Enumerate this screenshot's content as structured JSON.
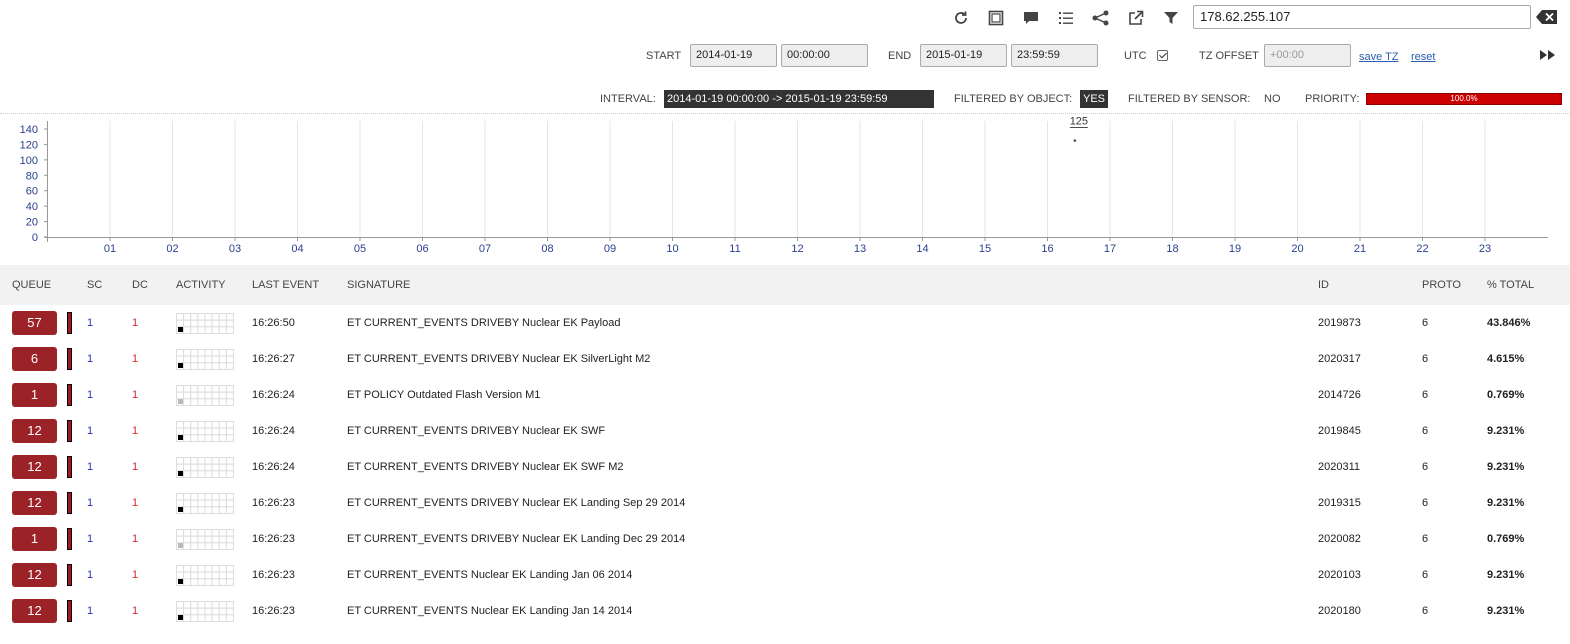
{
  "toolbar": {
    "icons": [
      "refresh-icon",
      "fullscreen-icon",
      "comment-icon",
      "list-icon",
      "graph-icon",
      "external-link-icon",
      "filter-icon"
    ],
    "search_value": "178.62.255.107"
  },
  "timerange": {
    "start_label": "START",
    "start_date": "2014-01-19",
    "start_time": "00:00:00",
    "end_label": "END",
    "end_date": "2015-01-19",
    "end_time": "23:59:59",
    "utc_label": "UTC",
    "utc_checked": true,
    "tz_label": "TZ OFFSET",
    "tz_placeholder": "+00:00",
    "save_tz": "save TZ",
    "reset": "reset"
  },
  "status": {
    "interval_label": "INTERVAL:",
    "interval_value": "2014-01-19 00:00:00 -> 2015-01-19 23:59:59 (+00:00)",
    "filtered_object_label": "FILTERED BY OBJECT:",
    "filtered_object_value": "YES",
    "filtered_sensor_label": "FILTERED BY SENSOR:",
    "filtered_sensor_value": "NO",
    "priority_label": "PRIORITY:",
    "priority_value": "100.0%",
    "priority_fraction": 1.0
  },
  "chart_data": {
    "type": "scatter",
    "y_ticks": [
      "140",
      "120",
      "100",
      "80",
      "60",
      "40",
      "20",
      "0"
    ],
    "ylim": [
      0,
      140
    ],
    "x_ticks": [
      "01",
      "02",
      "03",
      "04",
      "05",
      "06",
      "07",
      "08",
      "09",
      "10",
      "11",
      "12",
      "13",
      "14",
      "15",
      "16",
      "17",
      "18",
      "19",
      "20",
      "21",
      "22",
      "23"
    ],
    "xlim": [
      0,
      24
    ],
    "points": [
      {
        "x": 16.43,
        "y": 125,
        "label": "125"
      }
    ]
  },
  "table": {
    "headers": {
      "queue": "QUEUE",
      "sc": "SC",
      "dc": "DC",
      "activity": "ACTIVITY",
      "last_event": "LAST EVENT",
      "signature": "SIGNATURE",
      "id": "ID",
      "proto": "PROTO",
      "total": "% TOTAL"
    },
    "rows": [
      {
        "queue": "57",
        "sc": "1",
        "dc": "1",
        "last_event": "16:26:50",
        "signature": "ET CURRENT_EVENTS DRIVEBY Nuclear EK Payload",
        "id": "2019873",
        "proto": "6",
        "total": "43.846%",
        "activity_color": "#000000"
      },
      {
        "queue": "6",
        "sc": "1",
        "dc": "1",
        "last_event": "16:26:27",
        "signature": "ET CURRENT_EVENTS DRIVEBY Nuclear EK SilverLight M2",
        "id": "2020317",
        "proto": "6",
        "total": "4.615%",
        "activity_color": "#000000"
      },
      {
        "queue": "1",
        "sc": "1",
        "dc": "1",
        "last_event": "16:26:24",
        "signature": "ET POLICY Outdated Flash Version M1",
        "id": "2014726",
        "proto": "6",
        "total": "0.769%",
        "activity_color": "#bbbbbb"
      },
      {
        "queue": "12",
        "sc": "1",
        "dc": "1",
        "last_event": "16:26:24",
        "signature": "ET CURRENT_EVENTS DRIVEBY Nuclear EK SWF",
        "id": "2019845",
        "proto": "6",
        "total": "9.231%",
        "activity_color": "#000000"
      },
      {
        "queue": "12",
        "sc": "1",
        "dc": "1",
        "last_event": "16:26:24",
        "signature": "ET CURRENT_EVENTS DRIVEBY Nuclear EK SWF M2",
        "id": "2020311",
        "proto": "6",
        "total": "9.231%",
        "activity_color": "#000000"
      },
      {
        "queue": "12",
        "sc": "1",
        "dc": "1",
        "last_event": "16:26:23",
        "signature": "ET CURRENT_EVENTS DRIVEBY Nuclear EK Landing Sep 29 2014",
        "id": "2019315",
        "proto": "6",
        "total": "9.231%",
        "activity_color": "#000000"
      },
      {
        "queue": "1",
        "sc": "1",
        "dc": "1",
        "last_event": "16:26:23",
        "signature": "ET CURRENT_EVENTS DRIVEBY Nuclear EK Landing Dec 29 2014",
        "id": "2020082",
        "proto": "6",
        "total": "0.769%",
        "activity_color": "#bbbbbb"
      },
      {
        "queue": "12",
        "sc": "1",
        "dc": "1",
        "last_event": "16:26:23",
        "signature": "ET CURRENT_EVENTS Nuclear EK Landing Jan 06 2014",
        "id": "2020103",
        "proto": "6",
        "total": "9.231%",
        "activity_color": "#000000"
      },
      {
        "queue": "12",
        "sc": "1",
        "dc": "1",
        "last_event": "16:26:23",
        "signature": "ET CURRENT_EVENTS Nuclear EK Landing Jan 14 2014",
        "id": "2020180",
        "proto": "6",
        "total": "9.231%",
        "activity_color": "#000000"
      }
    ]
  }
}
